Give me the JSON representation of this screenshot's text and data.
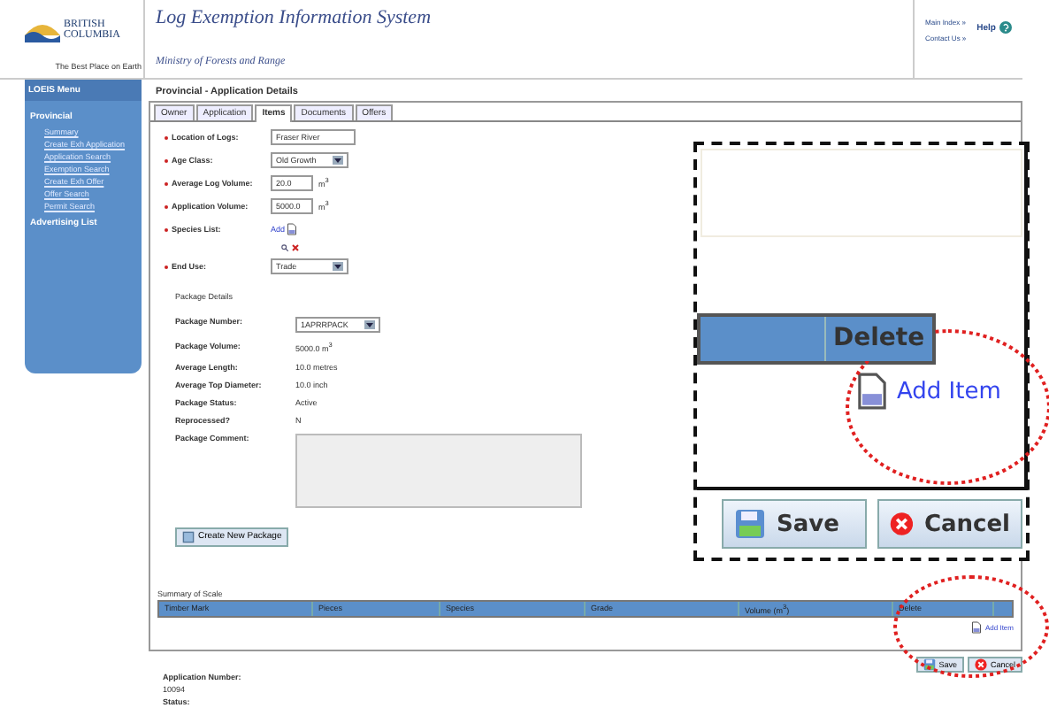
{
  "header": {
    "logo_lines": [
      "BRITISH",
      "COLUMBIA",
      "The Best Place on Earth"
    ],
    "title": "Log Exemption Information System",
    "subtitle": "Ministry of Forests and Range",
    "links": [
      "Main Index »",
      "Contact Us »"
    ],
    "help": "Help"
  },
  "sidebar": {
    "heading": "LOEIS Menu",
    "sections": [
      {
        "title": "Provincial",
        "items": [
          "Summary",
          "Create Exh Application",
          "Application Search",
          "Exemption Search",
          "Create Exh Offer",
          "Offer Search",
          "Permit Search"
        ]
      },
      {
        "title": "Advertising List"
      }
    ]
  },
  "page_title": "Provincial - Application Details",
  "tabs": [
    {
      "label": "Owner",
      "selected": false
    },
    {
      "label": "Application",
      "selected": false
    },
    {
      "label": "Items",
      "selected": true
    },
    {
      "label": "Documents",
      "selected": false
    },
    {
      "label": "Offers",
      "selected": false
    }
  ],
  "fields": [
    {
      "label": "Location of Logs:",
      "required": true,
      "kind": "text",
      "value": "Fraser River"
    },
    {
      "label": "Age Class:",
      "required": true,
      "kind": "select",
      "value": "Old Growth"
    },
    {
      "label": "Average Log Volume:",
      "required": true,
      "kind": "unit",
      "value": "20.0",
      "unit": "m$^{3}$"
    },
    {
      "label": "Application Volume:",
      "required": true,
      "kind": "unit",
      "value": "5000.0",
      "unit": "m$^{3}$"
    },
    {
      "label": "Species List:",
      "required": true,
      "kind": "add",
      "value": "Add"
    },
    {
      "label": "End Use:",
      "required": true,
      "kind": "select",
      "value": "Trade"
    }
  ],
  "package": {
    "heading": "Package Details",
    "rows": [
      {
        "label": "Package Number:",
        "kind": "select",
        "value": "1APRRPACK"
      },
      {
        "label": "Package Volume:",
        "kind": "text",
        "value": "5000.0 m$^{3}$"
      },
      {
        "label": "Average Length:",
        "kind": "text",
        "value": "10.0 metres"
      },
      {
        "label": "Average Top Diameter:",
        "kind": "text",
        "value": "10.0 inch"
      },
      {
        "label": "Package Status:",
        "kind": "text",
        "value": "Active"
      },
      {
        "label": "Reprocessed?",
        "kind": "text",
        "value": "N"
      },
      {
        "label": "Package Comment:",
        "kind": "area"
      }
    ],
    "button": "Create New Package"
  },
  "summary": {
    "title": "Summary of Scale",
    "columns": [
      "Timber Mark",
      "Pieces",
      "Species",
      "Grade",
      "Volume (m$^{3}$)",
      "Delete"
    ],
    "add_item": "Add Item"
  },
  "buttons": [
    "Save",
    "Cancel"
  ],
  "application": {
    "number_label": "Application Number:",
    "number": "10094",
    "status_label": "Status:"
  },
  "callout": {
    "column": "Delete",
    "add_item": "Add Item",
    "buttons": [
      "Save",
      "Cancel"
    ]
  }
}
